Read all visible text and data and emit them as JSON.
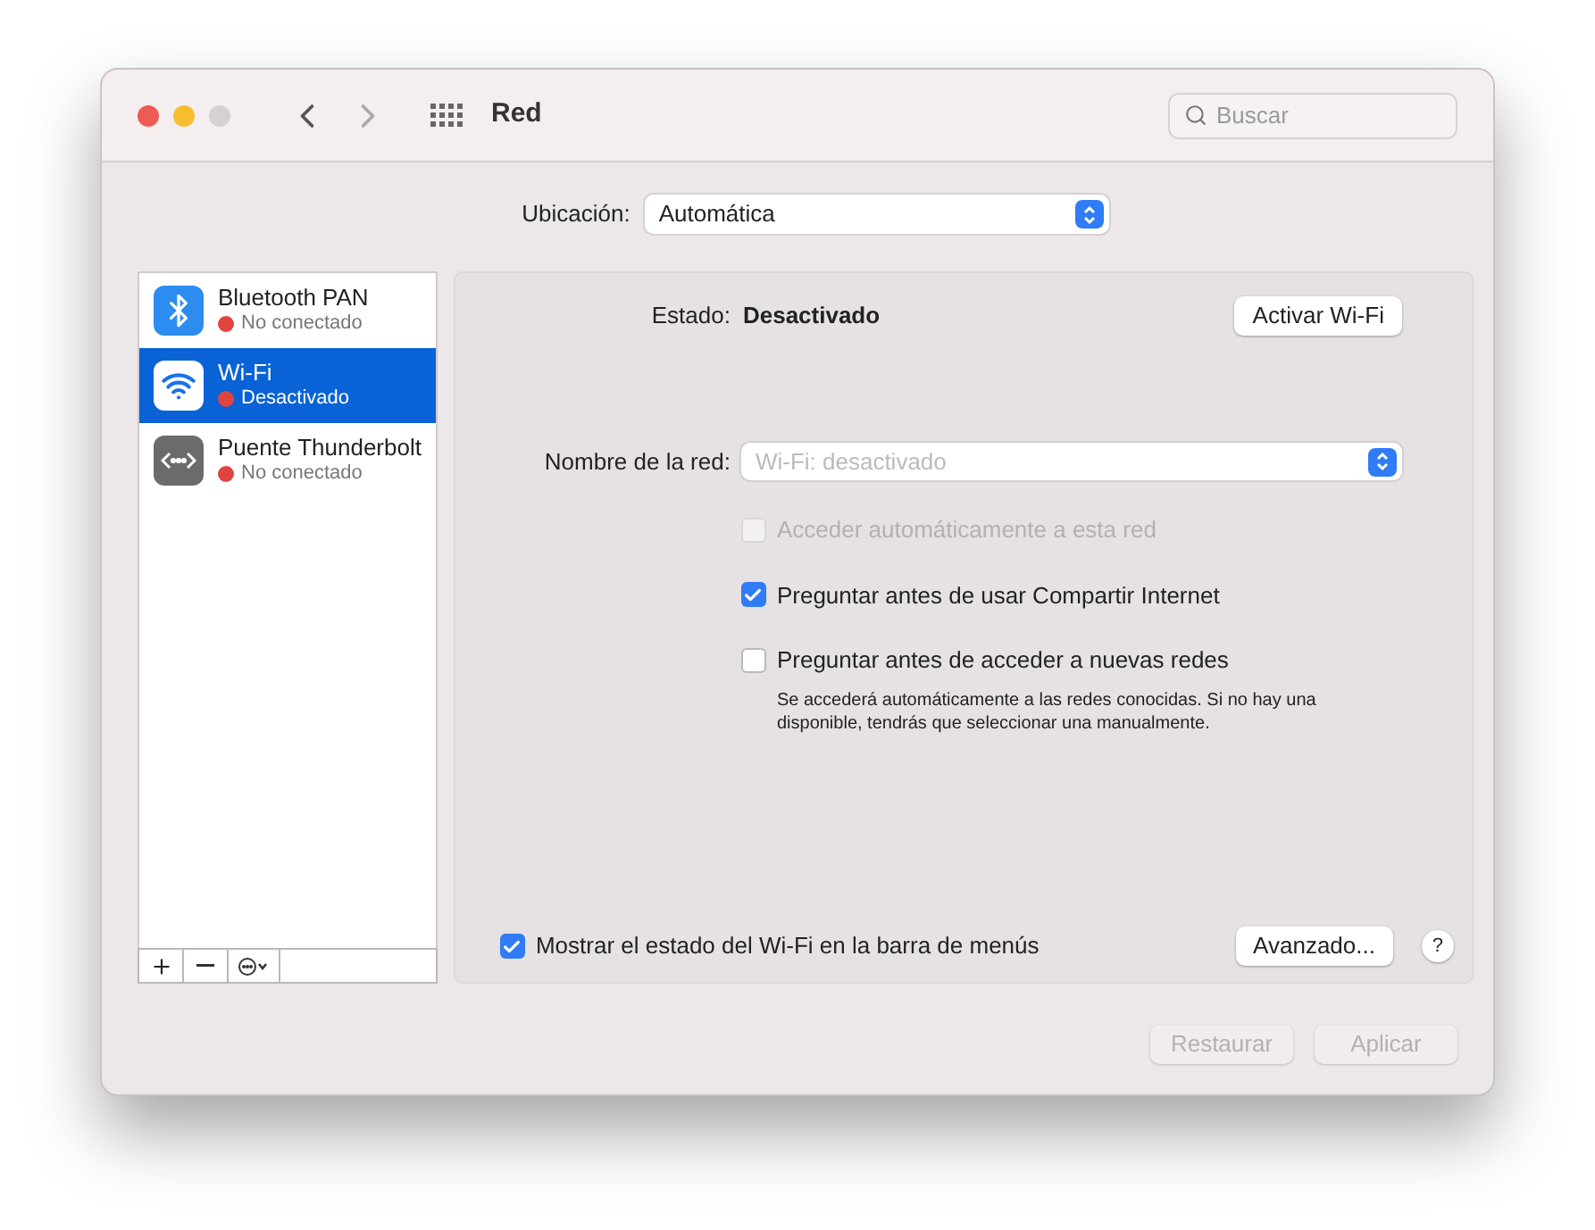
{
  "window": {
    "title": "Red"
  },
  "search": {
    "placeholder": "Buscar"
  },
  "location": {
    "label": "Ubicación:",
    "value": "Automática"
  },
  "services": [
    {
      "kind": "bluetooth",
      "name": "Bluetooth PAN",
      "status": "No conectado",
      "color": "#e0443e",
      "selected": false
    },
    {
      "kind": "wifi",
      "name": "Wi-Fi",
      "status": "Desactivado",
      "color": "#e0443e",
      "selected": true
    },
    {
      "kind": "thunderbolt",
      "name": "Puente Thunderbolt",
      "status": "No conectado",
      "color": "#e0443e",
      "selected": false
    }
  ],
  "status": {
    "label": "Estado:",
    "value": "Desactivado",
    "button": "Activar Wi-Fi"
  },
  "network_name": {
    "label": "Nombre de la red:",
    "value": "Wi-Fi: desactivado",
    "disabled": true
  },
  "options": [
    {
      "label": "Acceder automáticamente a esta red",
      "checked": false,
      "disabled": true
    },
    {
      "label": "Preguntar antes de usar Compartir Internet",
      "checked": true,
      "disabled": false
    },
    {
      "label": "Preguntar antes de acceder a nuevas redes",
      "checked": false,
      "disabled": false
    }
  ],
  "note": "Se accederá automáticamente a las redes conocidas. Si no hay una disponible, tendrás que seleccionar una manualmente.",
  "show_in_menu": {
    "label": "Mostrar el estado del Wi-Fi en la barra de menús",
    "checked": true
  },
  "advanced_button": "Avanzado...",
  "help_button": "?",
  "footer_buttons": [
    {
      "label": "Restaurar",
      "disabled": true
    },
    {
      "label": "Aplicar",
      "disabled": true
    }
  ]
}
